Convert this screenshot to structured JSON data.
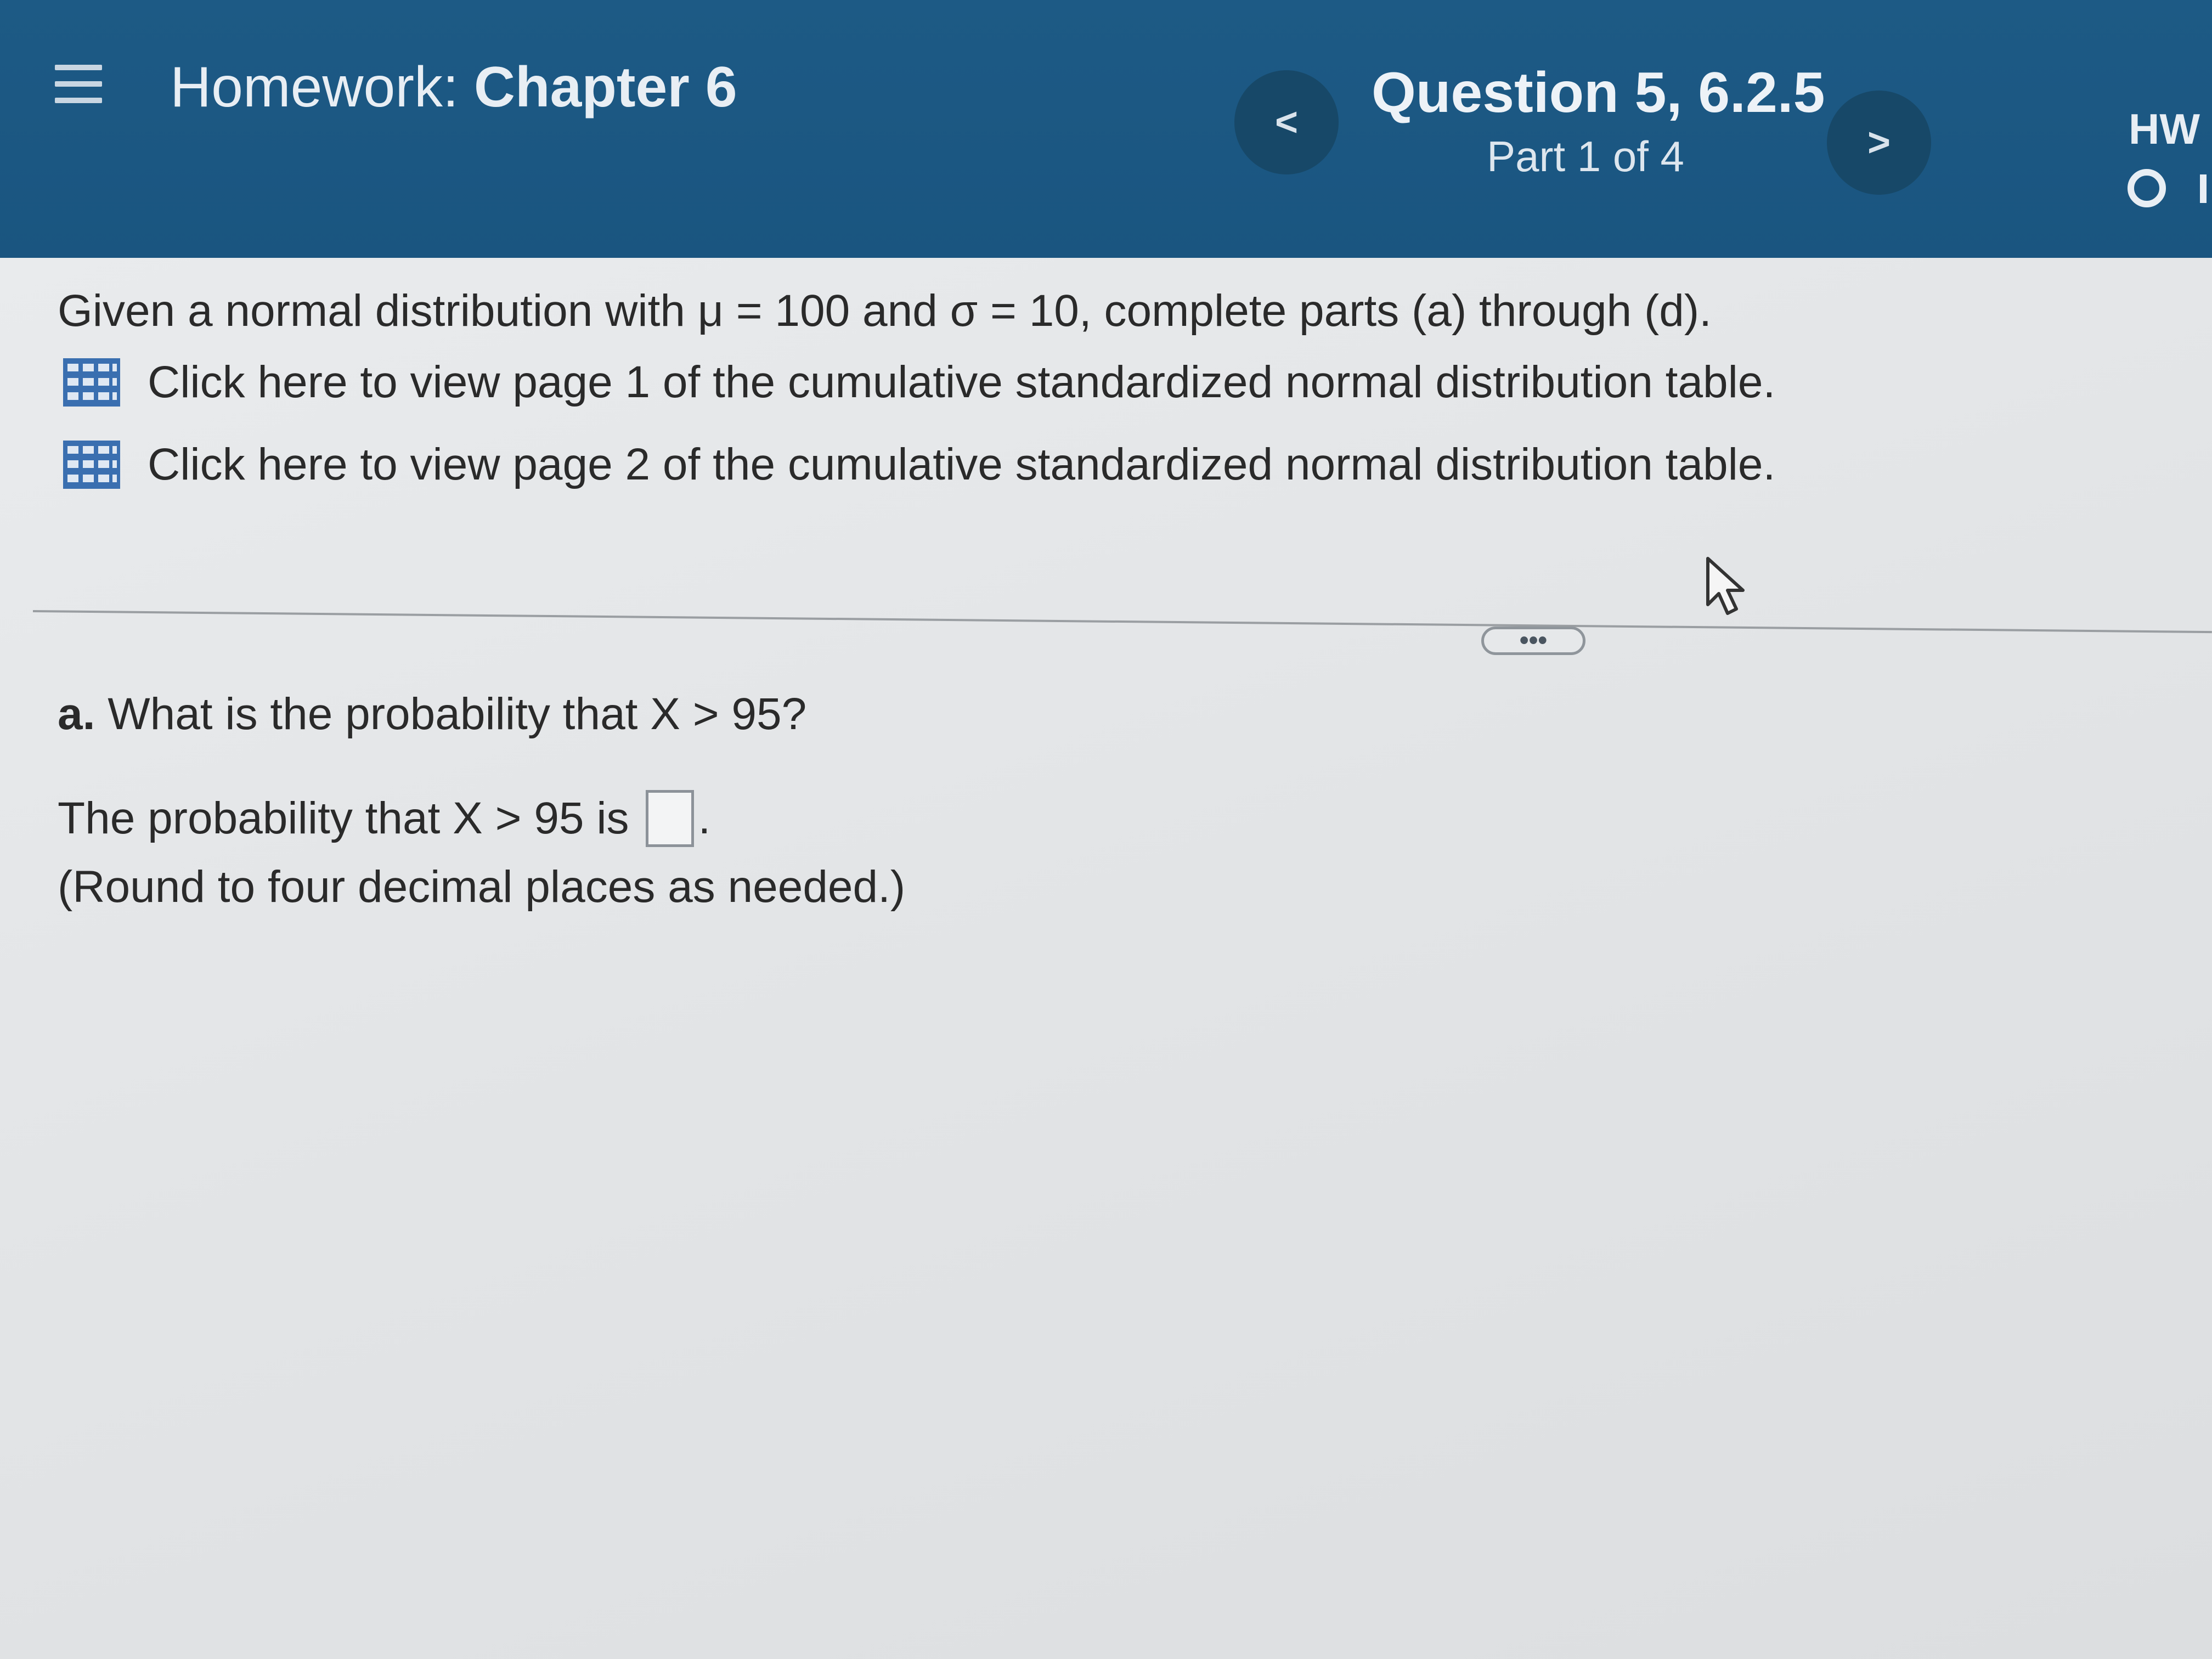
{
  "header": {
    "homework_label": "Homework:",
    "chapter_label": "Chapter 6",
    "question_title": "Question 5, 6.2.5",
    "question_part": "Part 1 of 4",
    "prev_glyph": "<",
    "next_glyph": ">",
    "hw_label": "HW"
  },
  "problem": {
    "intro": "Given a normal distribution with μ = 100 and σ = 10, complete parts (a) through (d).",
    "table_link_1": "Click here to view page 1 of the cumulative standardized normal distribution table.",
    "table_link_2": "Click here to view page 2 of the cumulative standardized normal distribution table.",
    "more_label": "•••"
  },
  "part_a": {
    "label": "a.",
    "question": "What is the probability that X > 95?",
    "answer_prefix": "The probability that X > 95 is",
    "answer_value": "",
    "answer_suffix": ".",
    "rounding_note": "(Round to four decimal places as needed.)"
  },
  "colors": {
    "header_bg": "#1d5a85",
    "nav_button_bg": "#174868",
    "content_bg": "#e4e6e8",
    "grid_icon": "#3a6fb0"
  },
  "icons": {
    "menu": "hamburger-menu-icon",
    "prev": "chevron-left-icon",
    "next": "chevron-right-icon",
    "status": "circle-status-icon",
    "table": "grid-table-icon",
    "cursor": "mouse-pointer-icon"
  }
}
